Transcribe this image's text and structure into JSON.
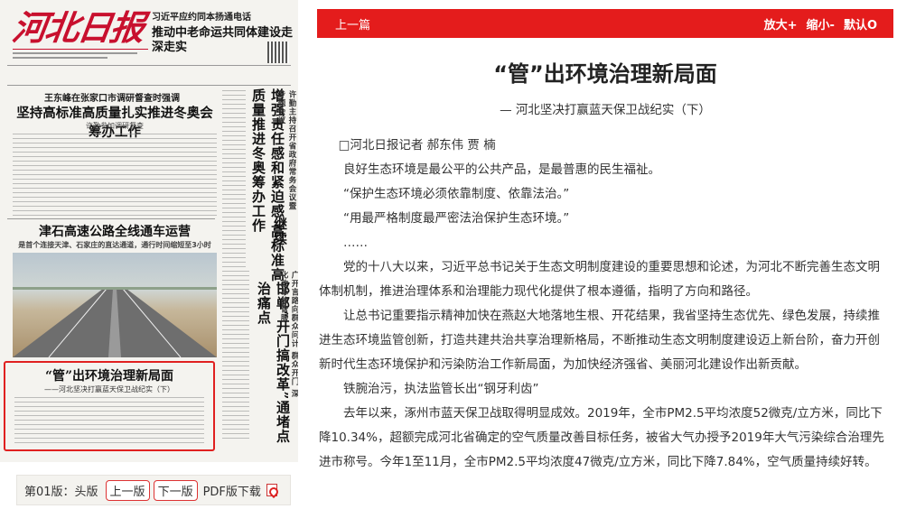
{
  "newspaper": {
    "masthead": "河北日报",
    "top_kicker": "习近平应约同本扬通电话",
    "top_headline": "推动中老命运共同体建设走深走实",
    "lead_kicker": "王东峰在张家口市调研督查时强调",
    "lead_title": "坚持高标准高质量扎实推进冬奥会筹办工作",
    "lead_sub": "许勤参加调研督查",
    "vertical_headline_1": "增强责任感和紧迫感 高标准高质量推进冬奥筹办工作",
    "vertical_headline_2": "继续",
    "vertical_small_1": "许勤主持召开省政府常务会议暨专题会议",
    "mid_title": "津石高速公路全线通车运营",
    "mid_sub": "是首个连接天津、石家庄的直达通道，通行时间缩短至3小时",
    "right_vertical_1": "邯郸“开门搞改革”通堵点治痛点",
    "right_vertical_small": "广开言路向群众问计 群众开门 深化改革放管服",
    "highlight_title": "“管”出环境治理新局面",
    "highlight_sub": "——河北坚决打赢蓝天保卫战纪实（下）"
  },
  "page_nav": {
    "edition_label": "第01版：头版",
    "prev_label": "上一版",
    "next_label": "下一版",
    "pdf_label": "PDF版下载"
  },
  "toolbar": {
    "prev_article": "上一篇",
    "zoom_in": "放大+",
    "zoom_out": "缩小-",
    "default": "默认O"
  },
  "article": {
    "title": "“管”出环境治理新局面",
    "subtitle": "— 河北坚决打赢蓝天保卫战纪实（下）",
    "paragraphs": [
      "□河北日报记者 郝东伟 贾 楠",
      "良好生态环境是最公平的公共产品，是最普惠的民生福祉。",
      "“保护生态环境必须依靠制度、依靠法治。”",
      "“用最严格制度最严密法治保护生态环境。”",
      "……",
      "党的十八大以来，习近平总书记关于生态文明制度建设的重要思想和论述，为河北不断完善生态文明体制机制，推进治理体系和治理能力现代化提供了根本遵循，指明了方向和路径。",
      "让总书记重要指示精神加快在燕赵大地落地生根、开花结果，我省坚持生态优先、绿色发展，持续推进生态环境监管创新，打造共建共治共享治理新格局，不断推动生态文明制度建设迈上新台阶，奋力开创新时代生态环境保护和污染防治工作新局面，为加快经济强省、美丽河北建设作出新贡献。",
      "铁腕治污，执法监管长出“钢牙利齿”",
      "去年以来，涿州市蓝天保卫战取得明显成效。2019年，全市PM2.5平均浓度52微克/立方米，同比下降10.34%，超额完成河北省确定的空气质量改善目标任务，被省大气办授予2019年大气污染综合治理先进市称号。今年1至11月，全市PM2.5平均浓度47微克/立方米，同比下降7.84%，空气质量持续好转。"
    ]
  },
  "colors": {
    "accent": "#e41c1c",
    "masthead": "#c8102e"
  }
}
